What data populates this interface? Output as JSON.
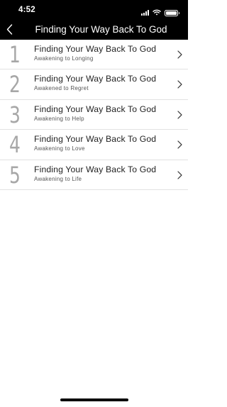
{
  "status_bar": {
    "time": "4:52"
  },
  "nav": {
    "title": "Finding Your Way Back To God"
  },
  "items": [
    {
      "number": "1",
      "title": "Finding Your Way Back To God",
      "subtitle": "Awakening to Longing"
    },
    {
      "number": "2",
      "title": "Finding Your Way Back To God",
      "subtitle": "Awakened to Regret"
    },
    {
      "number": "3",
      "title": "Finding Your Way Back To God",
      "subtitle": "Awakening to Help"
    },
    {
      "number": "4",
      "title": "Finding Your Way Back To God",
      "subtitle": "Awakening to Love"
    },
    {
      "number": "5",
      "title": "Finding Your Way Back To God",
      "subtitle": "Awakening to Life"
    }
  ]
}
